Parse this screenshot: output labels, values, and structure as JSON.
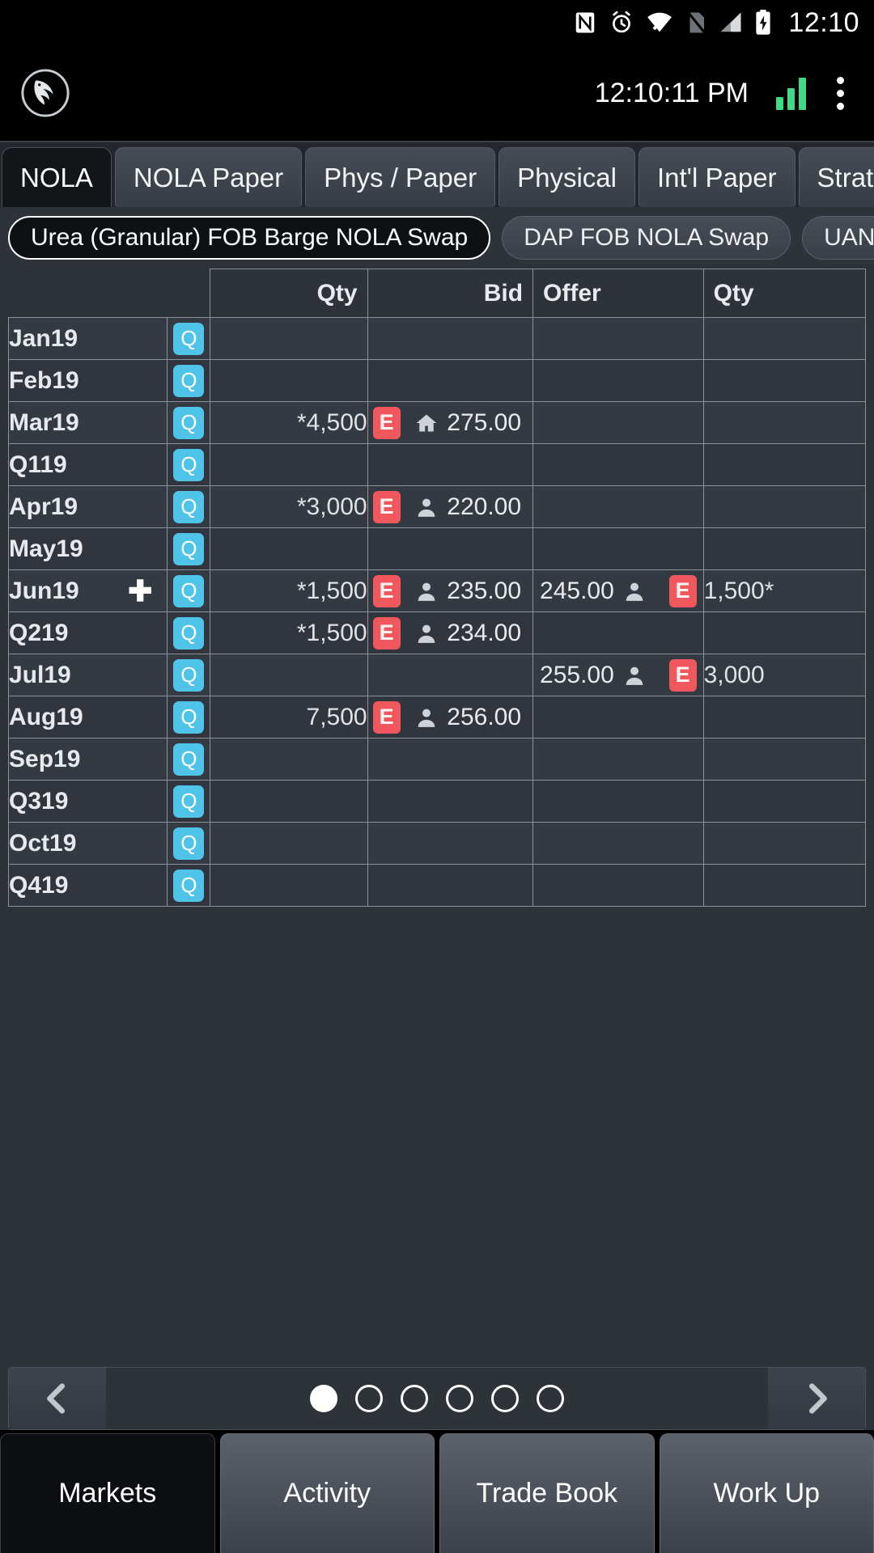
{
  "status_bar": {
    "icons": [
      "nfc-icon",
      "alarm-icon",
      "wifi-icon",
      "no-sim-icon",
      "cell-signal-icon",
      "battery-charging-icon"
    ],
    "time": "12:10"
  },
  "app_header": {
    "logo": "eagle-logo-icon",
    "time": "12:10:11 PM",
    "connection_icon": "signal-strength-icon",
    "menu_icon": "overflow-menu-icon"
  },
  "tabs": [
    {
      "label": "NOLA",
      "active": true
    },
    {
      "label": "NOLA Paper",
      "active": false
    },
    {
      "label": "Phys / Paper",
      "active": false
    },
    {
      "label": "Physical",
      "active": false
    },
    {
      "label": "Int'l Paper",
      "active": false
    },
    {
      "label": "Strategies",
      "active": false
    }
  ],
  "product_chips": [
    {
      "label": "Urea (Granular) FOB Barge NOLA Swap",
      "active": true
    },
    {
      "label": "DAP FOB NOLA Swap",
      "active": false
    },
    {
      "label": "UAN FOB NOLA Swap",
      "active": false
    }
  ],
  "grid": {
    "headers": {
      "period": "",
      "quote": "",
      "bid_qty": "Qty",
      "bid": "Bid",
      "offer": "Offer",
      "offer_qty": "Qty"
    },
    "quote_button_label": "Q",
    "edit_button_label": "E",
    "rows": [
      {
        "period": "Jan19",
        "expand": false,
        "bid_qty": "",
        "bid": "",
        "bid_icon": "",
        "bid_edit": false,
        "offer": "",
        "offer_icon": "",
        "offer_edit": false,
        "offer_qty": ""
      },
      {
        "period": "Feb19",
        "expand": false,
        "bid_qty": "",
        "bid": "",
        "bid_icon": "",
        "bid_edit": false,
        "offer": "",
        "offer_icon": "",
        "offer_edit": false,
        "offer_qty": ""
      },
      {
        "period": "Mar19",
        "expand": false,
        "bid_qty": "*4,500",
        "bid": "275.00",
        "bid_icon": "house-icon",
        "bid_edit": true,
        "offer": "",
        "offer_icon": "",
        "offer_edit": false,
        "offer_qty": ""
      },
      {
        "period": "Q119",
        "expand": false,
        "bid_qty": "",
        "bid": "",
        "bid_icon": "",
        "bid_edit": false,
        "offer": "",
        "offer_icon": "",
        "offer_edit": false,
        "offer_qty": ""
      },
      {
        "period": "Apr19",
        "expand": false,
        "bid_qty": "*3,000",
        "bid": "220.00",
        "bid_icon": "person-icon",
        "bid_edit": true,
        "offer": "",
        "offer_icon": "",
        "offer_edit": false,
        "offer_qty": ""
      },
      {
        "period": "May19",
        "expand": false,
        "bid_qty": "",
        "bid": "",
        "bid_icon": "",
        "bid_edit": false,
        "offer": "",
        "offer_icon": "",
        "offer_edit": false,
        "offer_qty": ""
      },
      {
        "period": "Jun19",
        "expand": true,
        "bid_qty": "*1,500",
        "bid": "235.00",
        "bid_icon": "person-icon",
        "bid_edit": true,
        "offer": "245.00",
        "offer_icon": "person-icon",
        "offer_edit": true,
        "offer_qty": "1,500*"
      },
      {
        "period": "Q219",
        "expand": false,
        "bid_qty": "*1,500",
        "bid": "234.00",
        "bid_icon": "person-icon",
        "bid_edit": true,
        "offer": "",
        "offer_icon": "",
        "offer_edit": false,
        "offer_qty": ""
      },
      {
        "period": "Jul19",
        "expand": false,
        "bid_qty": "",
        "bid": "",
        "bid_icon": "",
        "bid_edit": false,
        "offer": "255.00",
        "offer_icon": "person-icon",
        "offer_edit": true,
        "offer_qty": "3,000"
      },
      {
        "period": "Aug19",
        "expand": false,
        "bid_qty": "7,500",
        "bid": "256.00",
        "bid_icon": "person-icon",
        "bid_edit": true,
        "offer": "",
        "offer_icon": "",
        "offer_edit": false,
        "offer_qty": ""
      },
      {
        "period": "Sep19",
        "expand": false,
        "bid_qty": "",
        "bid": "",
        "bid_icon": "",
        "bid_edit": false,
        "offer": "",
        "offer_icon": "",
        "offer_edit": false,
        "offer_qty": ""
      },
      {
        "period": "Q319",
        "expand": false,
        "bid_qty": "",
        "bid": "",
        "bid_icon": "",
        "bid_edit": false,
        "offer": "",
        "offer_icon": "",
        "offer_edit": false,
        "offer_qty": ""
      },
      {
        "period": "Oct19",
        "expand": false,
        "bid_qty": "",
        "bid": "",
        "bid_icon": "",
        "bid_edit": false,
        "offer": "",
        "offer_icon": "",
        "offer_edit": false,
        "offer_qty": ""
      },
      {
        "period": "Q419",
        "expand": false,
        "bid_qty": "",
        "bid": "",
        "bid_icon": "",
        "bid_edit": false,
        "offer": "",
        "offer_icon": "",
        "offer_edit": false,
        "offer_qty": ""
      }
    ]
  },
  "pager": {
    "prev_icon": "chevron-left-icon",
    "next_icon": "chevron-right-icon",
    "total_pages": 6,
    "current_page": 1
  },
  "bottom_nav": [
    {
      "label": "Markets",
      "active": true
    },
    {
      "label": "Activity",
      "active": false
    },
    {
      "label": "Trade Book",
      "active": false
    },
    {
      "label": "Work Up",
      "active": false
    }
  ],
  "colors": {
    "quote_blue": "#4fc3e8",
    "edit_red": "#f0585e",
    "signal_green": "#3ddc84",
    "grid_bg": "#343a42",
    "page_bg": "#2e333a"
  }
}
